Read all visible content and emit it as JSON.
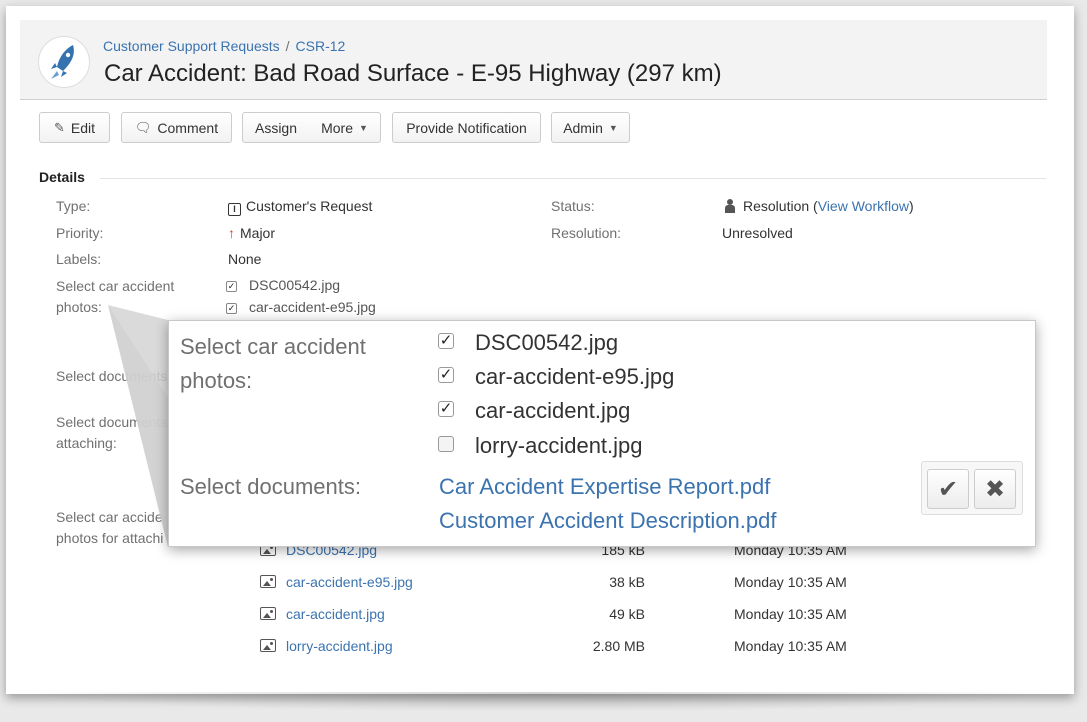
{
  "breadcrumb": {
    "project": "Customer Support Requests",
    "separator": "/",
    "issue_key": "CSR-12"
  },
  "issue": {
    "title": "Car Accident: Bad Road Surface - E-95 Highway (297 km)"
  },
  "toolbar": {
    "edit": "Edit",
    "comment": "Comment",
    "assign": "Assign",
    "more": "More",
    "provide_notification": "Provide Notification",
    "admin": "Admin"
  },
  "details": {
    "section_title": "Details",
    "type_label": "Type:",
    "type_value": "Customer's Request",
    "priority_label": "Priority:",
    "priority_value": "Major",
    "labels_label": "Labels:",
    "labels_value": "None",
    "photos_label_line1": "Select car accident",
    "photos_label_line2": "photos:",
    "photos_selected": [
      "DSC00542.jpg",
      "car-accident-e95.jpg"
    ],
    "documents_label": "Select documents",
    "docs_attach_label_line1": "Select documents",
    "docs_attach_label_line2": "attaching:",
    "photos_attach_label_line1": "Select car accide",
    "photos_attach_label_line2": "photos for attachi",
    "status_label": "Status:",
    "status_value": "Resolution",
    "status_open_paren": "(",
    "status_link": "View Workflow",
    "status_close_paren": ")",
    "resolution_label": "Resolution:",
    "resolution_value": "Unresolved"
  },
  "attachments": [
    {
      "name": "DSC00542.jpg",
      "size": "185 kB",
      "date": "Monday 10:35 AM"
    },
    {
      "name": "car-accident-e95.jpg",
      "size": "38 kB",
      "date": "Monday 10:35 AM"
    },
    {
      "name": "car-accident.jpg",
      "size": "49 kB",
      "date": "Monday 10:35 AM"
    },
    {
      "name": "lorry-accident.jpg",
      "size": "2.80 MB",
      "date": "Monday 10:35 AM"
    }
  ],
  "zoom": {
    "photos_label_line1": "Select car accident",
    "photos_label_line2": "photos:",
    "photo_options": [
      {
        "label": "DSC00542.jpg",
        "checked": true
      },
      {
        "label": "car-accident-e95.jpg",
        "checked": true
      },
      {
        "label": "car-accident.jpg",
        "checked": true
      },
      {
        "label": "lorry-accident.jpg",
        "checked": false
      }
    ],
    "documents_label": "Select documents:",
    "documents": [
      "Car Accident Expertise Report.pdf",
      "Customer Accident Description.pdf"
    ]
  },
  "icons": {
    "avatar": "rocket-icon",
    "edit": "pencil-icon",
    "comment": "speech-bubble-icon",
    "type": "request-type-icon",
    "priority": "arrow-up-icon",
    "status": "person-icon",
    "attachment": "image-icon",
    "save": "check-icon",
    "cancel": "close-icon"
  },
  "colors": {
    "link": "#3b73af",
    "priority_major": "#d04437",
    "header_bg": "#f3f3f3"
  }
}
